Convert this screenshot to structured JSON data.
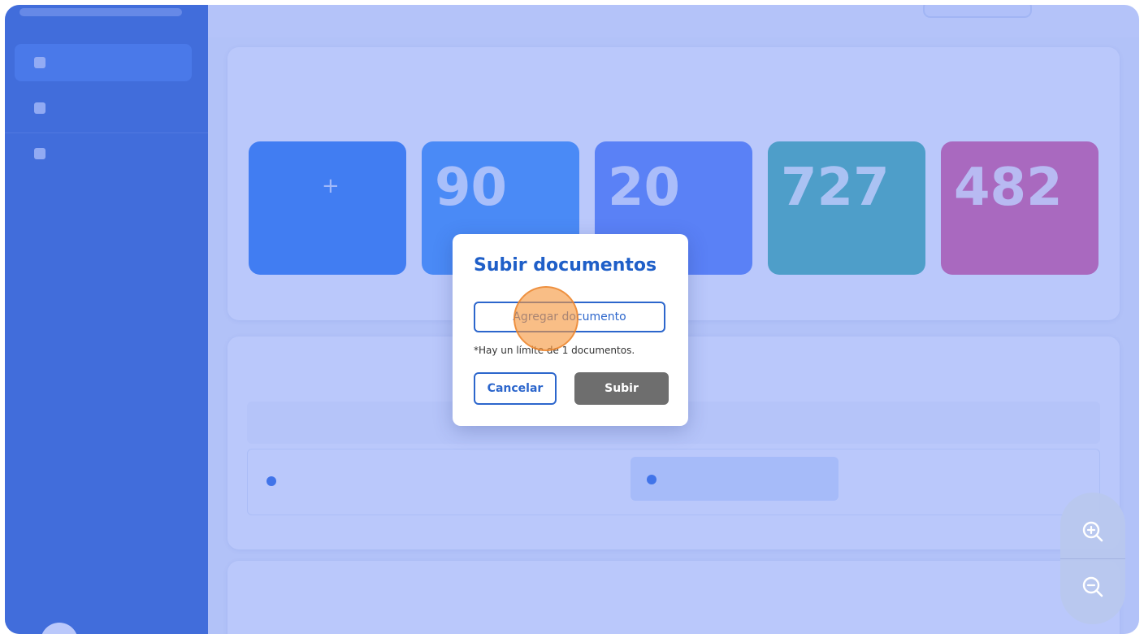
{
  "modal": {
    "title": "Subir documentos",
    "add_button": "Agregar documento",
    "note": "*Hay un límite de 1 documentos.",
    "cancel_button": "Cancelar",
    "submit_button": "Subir"
  },
  "dashboard": {
    "cards": [
      {
        "number": "+"
      },
      {
        "number": "90"
      },
      {
        "number": "20"
      },
      {
        "number": "727"
      },
      {
        "number": "482"
      }
    ]
  },
  "zoom": {
    "zoom_in_icon": "zoom-in-icon",
    "zoom_out_icon": "zoom-out-icon"
  },
  "colors": {
    "primary": "#2c66cc",
    "sidebar": "#2f62c8",
    "submit_disabled": "#6e6e6e",
    "overlay": "#5a7df5",
    "click_indicator": "#f5963c"
  }
}
